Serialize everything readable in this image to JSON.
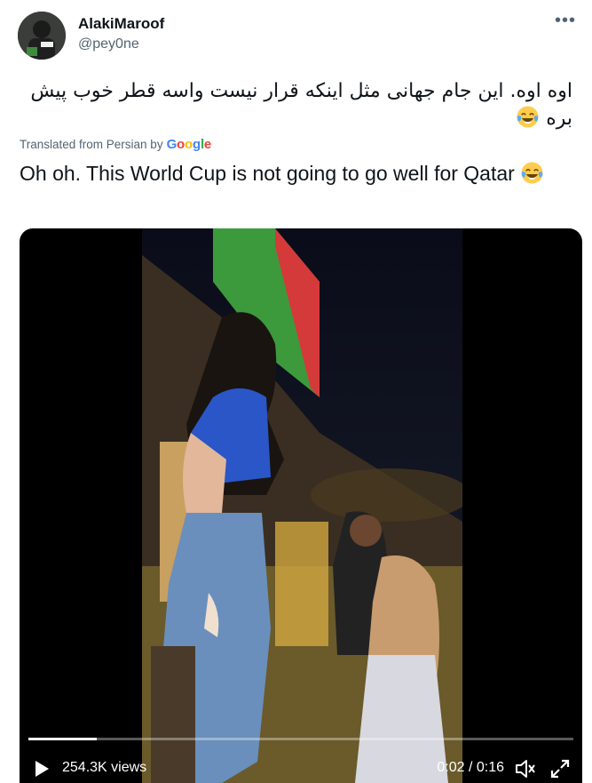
{
  "tweet": {
    "display_name": "AlakiMaroof",
    "handle": "@pey0ne",
    "more_label": "•••",
    "original_text": "اوه اوه. این جام جهانی مثل اینکه قرار نیست واسه قطر خوب پیش بره",
    "translated_from": "Translated from Persian by",
    "translator_brand": "Google",
    "translation_text": "Oh oh. This World Cup is not going to go well for Qatar",
    "emoji": "face-with-tears-of-joy-icon"
  },
  "video": {
    "views": "254.3K views",
    "time": "0:02 / 0:16",
    "progress": 0.125,
    "controls": [
      "play-icon",
      "volume-icon",
      "fullscreen-icon"
    ]
  },
  "colors": {
    "text": "#0f1419",
    "secondary": "#536471",
    "video_bg": "#000000"
  }
}
